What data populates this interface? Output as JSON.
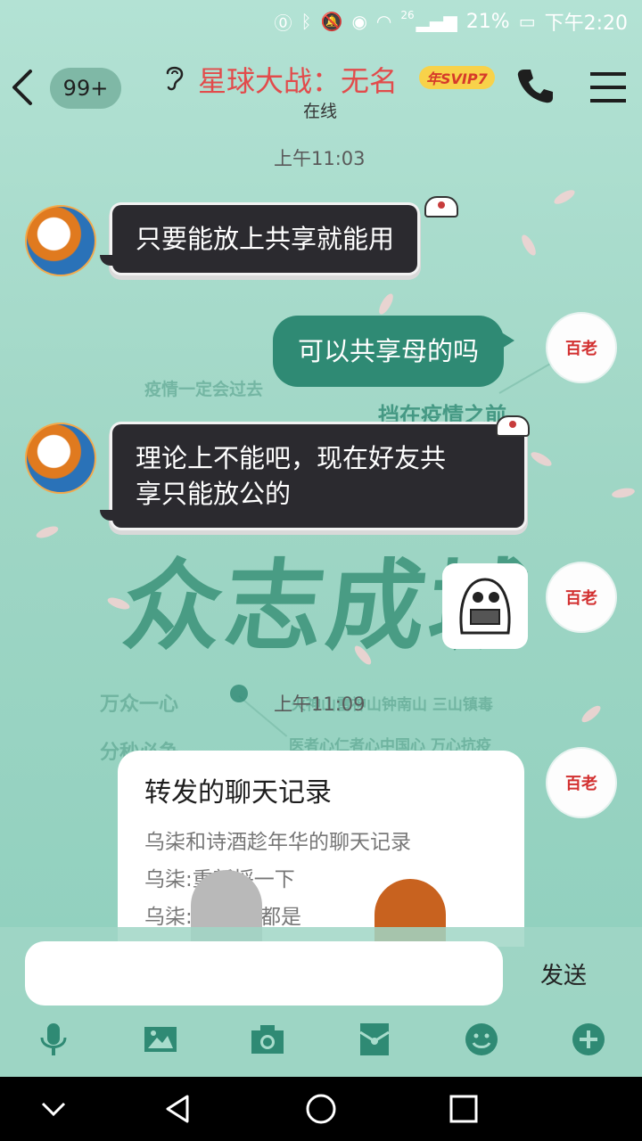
{
  "status_bar": {
    "network": "26",
    "battery": "21%",
    "time": "下午2:20"
  },
  "header": {
    "unread_badge": "99+",
    "title": "星球大战：无名",
    "vip_label": "年SVIP7",
    "status": "在线"
  },
  "messages": {
    "time1": "上午11:03",
    "m1": "只要能放上共享就能用",
    "m2": "可以共享母的吗",
    "m3_line1": "理论上不能吧，现在好友共",
    "m3_line2": "享只能放公的",
    "time2": "上午11:09",
    "forwarded": {
      "title": "转发的聊天记录",
      "line1": "乌柒和诗酒趁年华的聊天记录",
      "line2": "乌柒:重新捋一下",
      "line3": "乌柒:    在说的都是"
    }
  },
  "background_text": {
    "big": "众志成城",
    "t1": "疫情一定会过去",
    "t2": "挡在疫情之前",
    "t3": "万众一心",
    "t4": "分秒必争",
    "t5": "火神山雷神山钟南山 三山镇毒",
    "t6": "医者心仁者心中国心 万心抗疫"
  },
  "input": {
    "value": "",
    "send_label": "发送"
  },
  "colors": {
    "accent": "#2f8a74",
    "title_red": "#e24b4b",
    "background": "#a8dccc"
  }
}
